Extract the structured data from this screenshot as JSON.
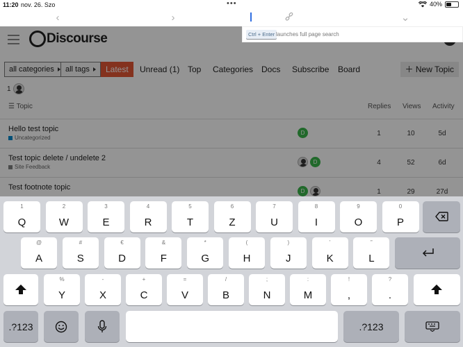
{
  "status": {
    "time": "11:20",
    "date": "nov. 26. Szo",
    "battery": "40%",
    "battery_level": 0.4
  },
  "tooltip": {
    "key": "Ctrl + Enter",
    "text": "launches full page search"
  },
  "site": {
    "logo": "Discourse"
  },
  "nav": {
    "categories_dd": "all categories",
    "tags_dd": "all tags",
    "items": [
      "Latest",
      "Unread (1)",
      "Top",
      "Categories",
      "Docs",
      "Subscribe",
      "Board"
    ],
    "new_topic": "New Topic"
  },
  "user_count": "1",
  "table": {
    "headers": {
      "topic": "Topic",
      "replies": "Replies",
      "views": "Views",
      "activity": "Activity"
    },
    "rows": [
      {
        "title": "Hello test topic",
        "category": "Uncategorized",
        "cat_color": "#0088cc",
        "replies": "1",
        "views": "10",
        "activity": "5d"
      },
      {
        "title": "Test topic delete / undelete 2",
        "category": "Site Feedback",
        "cat_color": "#808281",
        "replies": "4",
        "views": "52",
        "activity": "6d"
      },
      {
        "title": "Test footnote topic",
        "category": "",
        "cat_color": "#808281",
        "replies": "1",
        "views": "29",
        "activity": "27d"
      }
    ],
    "poster_letter": "D"
  },
  "keyboard": {
    "row1": [
      {
        "sub": "1",
        "main": "Q"
      },
      {
        "sub": "2",
        "main": "W"
      },
      {
        "sub": "3",
        "main": "E"
      },
      {
        "sub": "4",
        "main": "R"
      },
      {
        "sub": "5",
        "main": "T"
      },
      {
        "sub": "6",
        "main": "Z"
      },
      {
        "sub": "7",
        "main": "U"
      },
      {
        "sub": "8",
        "main": "I"
      },
      {
        "sub": "9",
        "main": "O"
      },
      {
        "sub": "0",
        "main": "P"
      }
    ],
    "row2": [
      {
        "sub": "@",
        "main": "A"
      },
      {
        "sub": "#",
        "main": "S"
      },
      {
        "sub": "€",
        "main": "D"
      },
      {
        "sub": "&",
        "main": "F"
      },
      {
        "sub": "*",
        "main": "G"
      },
      {
        "sub": "(",
        "main": "H"
      },
      {
        "sub": ")",
        "main": "J"
      },
      {
        "sub": "’",
        "main": "K"
      },
      {
        "sub": "”",
        "main": "L"
      }
    ],
    "row3": [
      {
        "sub": "%",
        "main": "Y"
      },
      {
        "sub": "-",
        "main": "X"
      },
      {
        "sub": "+",
        "main": "C"
      },
      {
        "sub": "=",
        "main": "V"
      },
      {
        "sub": "/",
        "main": "B"
      },
      {
        "sub": ";",
        "main": "N"
      },
      {
        "sub": ":",
        "main": "M"
      },
      {
        "sub": "!",
        "main": ","
      },
      {
        "sub": "?",
        "main": "."
      }
    ],
    "numbers_label": ".?123"
  }
}
